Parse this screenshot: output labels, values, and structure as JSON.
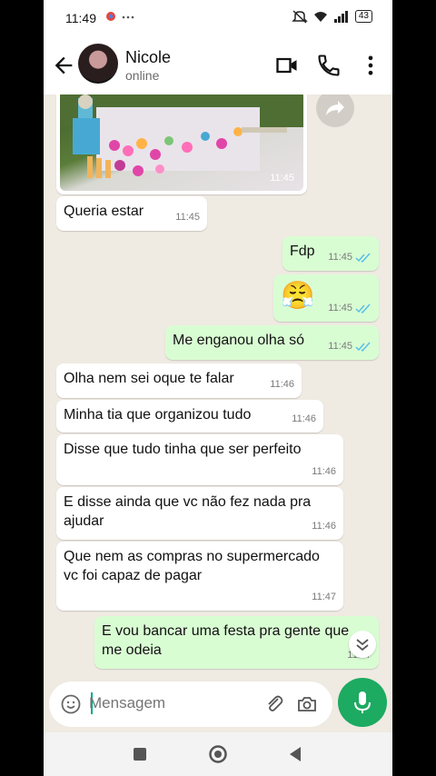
{
  "status_bar": {
    "time": "11:49",
    "battery": "43"
  },
  "header": {
    "contact_name": "Nicole",
    "contact_status": "online"
  },
  "messages": [
    {
      "text": "",
      "time": "11:45"
    },
    {
      "text": "Queria estar",
      "time": "11:45"
    },
    {
      "text": "Fdp",
      "time": "11:45"
    },
    {
      "text": "😤",
      "time": "11:45"
    },
    {
      "text": "Me enganou olha só",
      "time": "11:45"
    },
    {
      "text": "Olha nem sei oque te falar",
      "time": "11:46"
    },
    {
      "text": "Minha tia que organizou tudo",
      "time": "11:46"
    },
    {
      "text": "Disse que tudo tinha que ser perfeito",
      "time": "11:46"
    },
    {
      "text": "E disse ainda que vc não fez nada pra ajudar",
      "time": "11:46"
    },
    {
      "text": "Que nem as compras no supermercado vc foi capaz de pagar",
      "time": "11:47"
    },
    {
      "text": "E vou bancar uma festa pra gente que me odeia",
      "time": "11:47"
    }
  ],
  "composer": {
    "placeholder": "Mensagem"
  },
  "colors": {
    "outgoing": "#d9fdd3",
    "incoming": "#ffffff",
    "accent": "#1daa61",
    "ticks": "#53bdeb"
  },
  "icons": [
    "back-arrow-icon",
    "video-call-icon",
    "phone-icon",
    "more-options-icon",
    "forward-icon",
    "emoji-icon",
    "attach-icon",
    "camera-icon",
    "mic-icon",
    "scroll-down-icon",
    "nav-recents-icon",
    "nav-home-icon",
    "nav-back-icon"
  ]
}
